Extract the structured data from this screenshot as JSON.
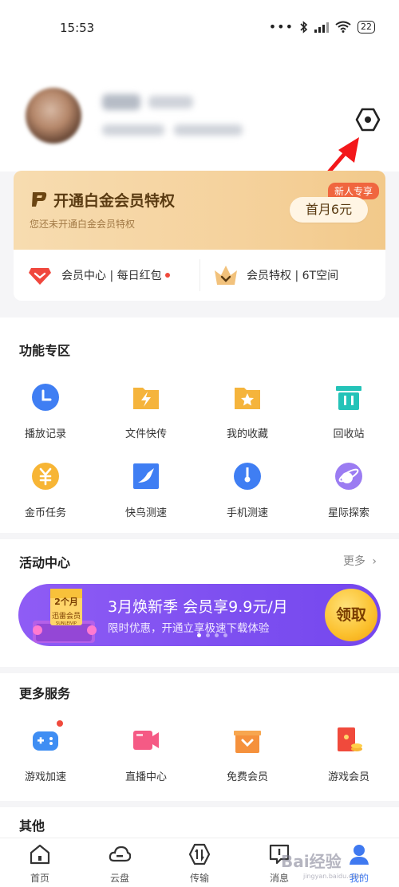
{
  "status_bar": {
    "time": "15:53",
    "battery": "22"
  },
  "profile": {
    "settings_icon": "hexagon-settings-icon"
  },
  "vip": {
    "title": "开通白金会员特权",
    "subtitle": "您还未开通白金会员特权",
    "badge": "新人专享",
    "button": "首月6元",
    "member_center": "会员中心 | 每日红包",
    "member_privilege": "会员特权 | 6T空间"
  },
  "features": {
    "title": "功能专区",
    "items": [
      {
        "label": "播放记录",
        "icon": "clock-icon",
        "color": "#3f7ef3"
      },
      {
        "label": "文件快传",
        "icon": "lightning-folder-icon",
        "color": "#f5b43c"
      },
      {
        "label": "我的收藏",
        "icon": "star-folder-icon",
        "color": "#f5b43c"
      },
      {
        "label": "回收站",
        "icon": "trash-icon",
        "color": "#24c3b8"
      },
      {
        "label": "金币任务",
        "icon": "coin-icon",
        "color": "#f7b535"
      },
      {
        "label": "快鸟测速",
        "icon": "bird-icon",
        "color": "#3f7ef3"
      },
      {
        "label": "手机测速",
        "icon": "speedometer-icon",
        "color": "#3f7ef3"
      },
      {
        "label": "星际探索",
        "icon": "planet-icon",
        "color": "#9b7cf2"
      }
    ]
  },
  "activity": {
    "title": "活动中心",
    "more": "更多",
    "banner_title": "3月焕新季 会员享9.9元/月",
    "banner_sub": "限时优惠，开通立享极速下载体验",
    "banner_button": "领取",
    "gift_top": "2个月",
    "gift_label": "迅雷会员",
    "gift_brand": "SUNLEIVIP"
  },
  "services": {
    "title": "更多服务",
    "items": [
      {
        "label": "游戏加速",
        "icon": "gamepad-icon",
        "color": "#3f8ef3"
      },
      {
        "label": "直播中心",
        "icon": "video-camera-icon",
        "color": "#f55a85"
      },
      {
        "label": "免费会员",
        "icon": "gift-box-icon",
        "color": "#f5913c"
      },
      {
        "label": "游戏会员",
        "icon": "red-packet-icon",
        "color": "#f04a3c"
      }
    ]
  },
  "others": {
    "title": "其他"
  },
  "tabs": [
    {
      "label": "首页",
      "icon": "home-icon"
    },
    {
      "label": "云盘",
      "icon": "cloud-icon"
    },
    {
      "label": "传输",
      "icon": "transfer-icon"
    },
    {
      "label": "消息",
      "icon": "message-icon"
    },
    {
      "label": "我的",
      "icon": "profile-icon",
      "active": true
    }
  ],
  "watermark": {
    "text": "Bai经验",
    "sub": "jingyan.baidu.com"
  }
}
